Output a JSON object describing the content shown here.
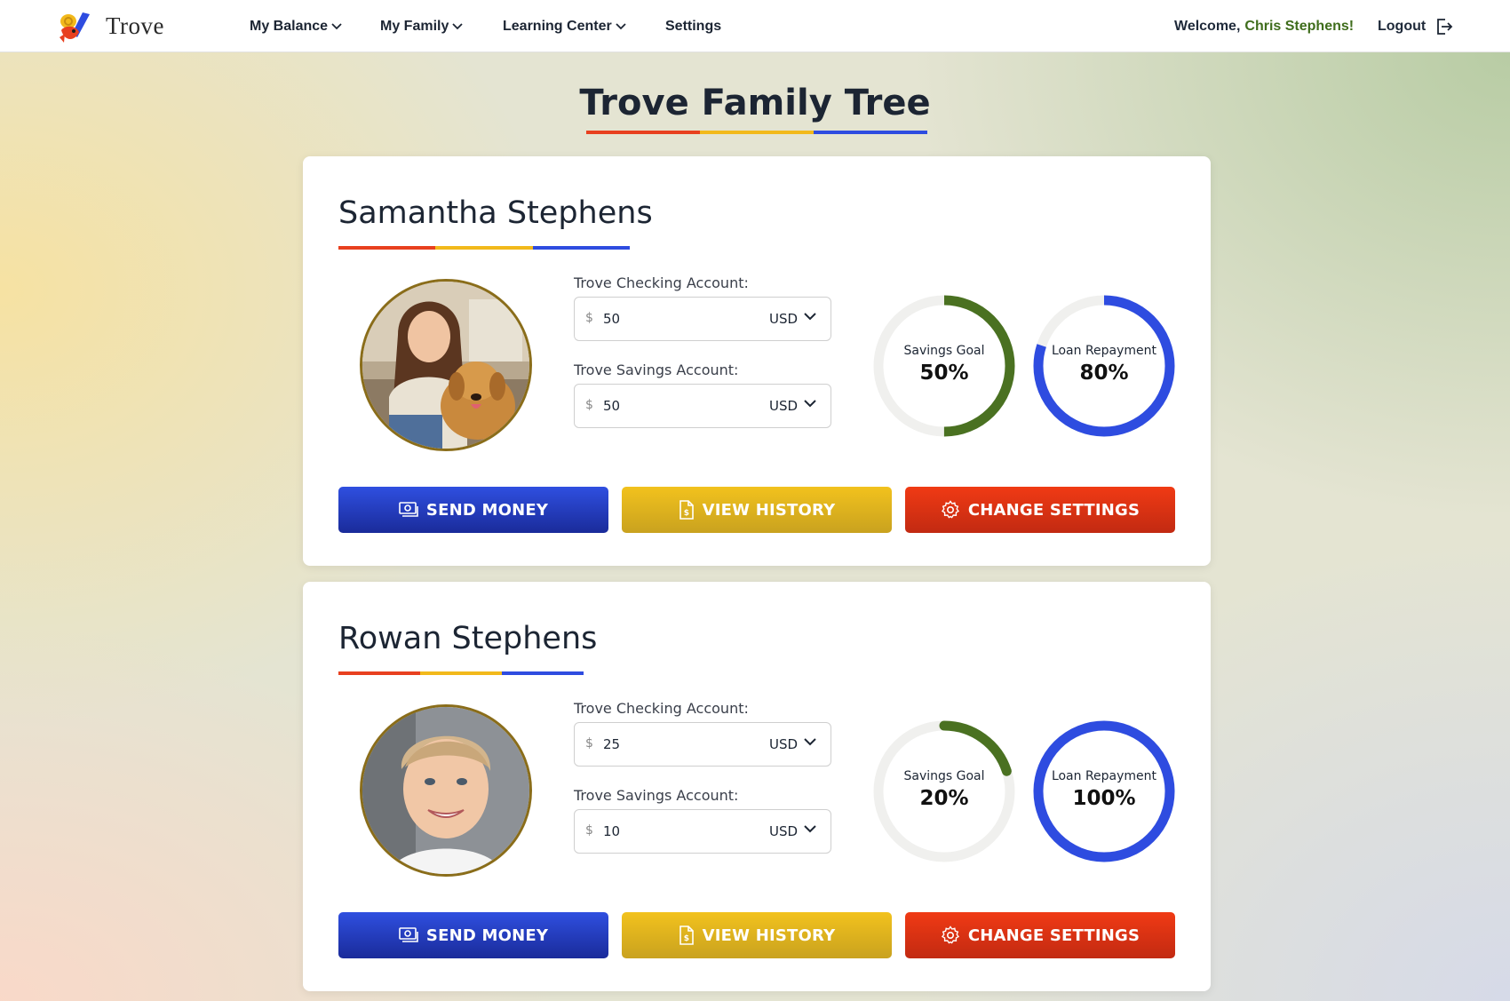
{
  "header": {
    "logo_text": "Trove",
    "nav": [
      {
        "label": "My Balance"
      },
      {
        "label": "My Family"
      },
      {
        "label": "Learning Center"
      },
      {
        "label": "Settings"
      }
    ],
    "welcome_prefix": "Welcome,",
    "welcome_name": "Chris Stephens!",
    "logout_label": "Logout"
  },
  "page": {
    "title": "Trove Family Tree"
  },
  "colors": {
    "red": "#e8401f",
    "yellow": "#f2b91b",
    "blue": "#2e4ce0",
    "green": "#4a7121"
  },
  "members": [
    {
      "name": "Samantha Stephens",
      "checking_label": "Trove Checking Account:",
      "checking_amount": "50",
      "checking_currency": "USD",
      "savings_label": "Trove Savings Account:",
      "savings_amount": "50",
      "savings_currency": "USD",
      "savings_goal_label": "Savings Goal",
      "savings_goal_value": "50%",
      "savings_goal_fraction": 0.5,
      "loan_label": "Loan Repayment",
      "loan_value": "80%",
      "loan_fraction": 0.8,
      "send_label": "SEND MONEY",
      "history_label": "VIEW HISTORY",
      "settings_label": "CHANGE SETTINGS"
    },
    {
      "name": "Rowan Stephens",
      "checking_label": "Trove Checking Account:",
      "checking_amount": "25",
      "checking_currency": "USD",
      "savings_label": "Trove Savings Account:",
      "savings_amount": "10",
      "savings_currency": "USD",
      "savings_goal_label": "Savings Goal",
      "savings_goal_value": "20%",
      "savings_goal_fraction": 0.2,
      "loan_label": "Loan Repayment",
      "loan_value": "100%",
      "loan_fraction": 1.0,
      "send_label": "SEND MONEY",
      "history_label": "VIEW HISTORY",
      "settings_label": "CHANGE SETTINGS"
    }
  ]
}
